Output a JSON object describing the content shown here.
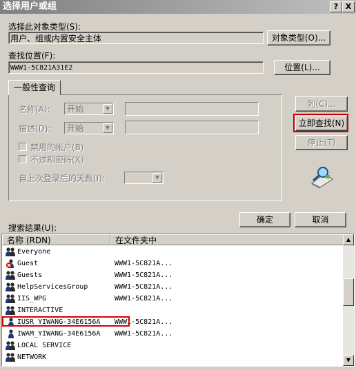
{
  "window": {
    "title": "选择用户或组",
    "help_btn": "?",
    "close_btn": "X"
  },
  "object_type": {
    "label": "选择此对象类型(S):",
    "value": "用户、组或内置安全主体",
    "button": "对象类型(O)..."
  },
  "location": {
    "label": "查找位置(F):",
    "value": "WWW1-5C821A31E2",
    "button": "位置(L)..."
  },
  "query_tab": {
    "label": "一般性查询"
  },
  "query": {
    "name_label": "名称(A):",
    "name_mode": "开始",
    "desc_label": "描述(D):",
    "desc_mode": "开始",
    "disabled_label": "禁用的帐户(B)",
    "noexpire_label": "不过期密码(X)",
    "days_label": "自上次登录后的天数(I):"
  },
  "buttons": {
    "columns": "列(C)...",
    "find_now": "立即查找(N)",
    "stop": "停止(T)",
    "ok": "确定",
    "cancel": "取消"
  },
  "results": {
    "label": "搜索结果(U):",
    "col_name": "名称 (RDN)",
    "col_folder": "在文件夹中",
    "rows": [
      {
        "name": "Everyone",
        "folder": "",
        "icon": "group-icon"
      },
      {
        "name": "Guest",
        "folder": "WWW1-5C821A...",
        "icon": "disabled-user-icon"
      },
      {
        "name": "Guests",
        "folder": "WWW1-5C821A...",
        "icon": "group-icon"
      },
      {
        "name": "HelpServicesGroup",
        "folder": "WWW1-5C821A...",
        "icon": "group-icon"
      },
      {
        "name": "IIS_WPG",
        "folder": "WWW1-5C821A...",
        "icon": "group-icon"
      },
      {
        "name": "INTERACTIVE",
        "folder": "",
        "icon": "group-icon"
      },
      {
        "name": "IUSR_YIWANG-34E6156A",
        "folder": "WWW1-5C821A...",
        "icon": "user-icon"
      },
      {
        "name": "IWAM_YIWANG-34E6156A",
        "folder": "WWW1-5C821A...",
        "icon": "user-icon"
      },
      {
        "name": "LOCAL SERVICE",
        "folder": "",
        "icon": "group-icon"
      },
      {
        "name": "NETWORK",
        "folder": "",
        "icon": "group-icon"
      }
    ]
  },
  "colors": {
    "highlight_box": "#d40000",
    "dialog_bg": "#d4d0c8"
  }
}
